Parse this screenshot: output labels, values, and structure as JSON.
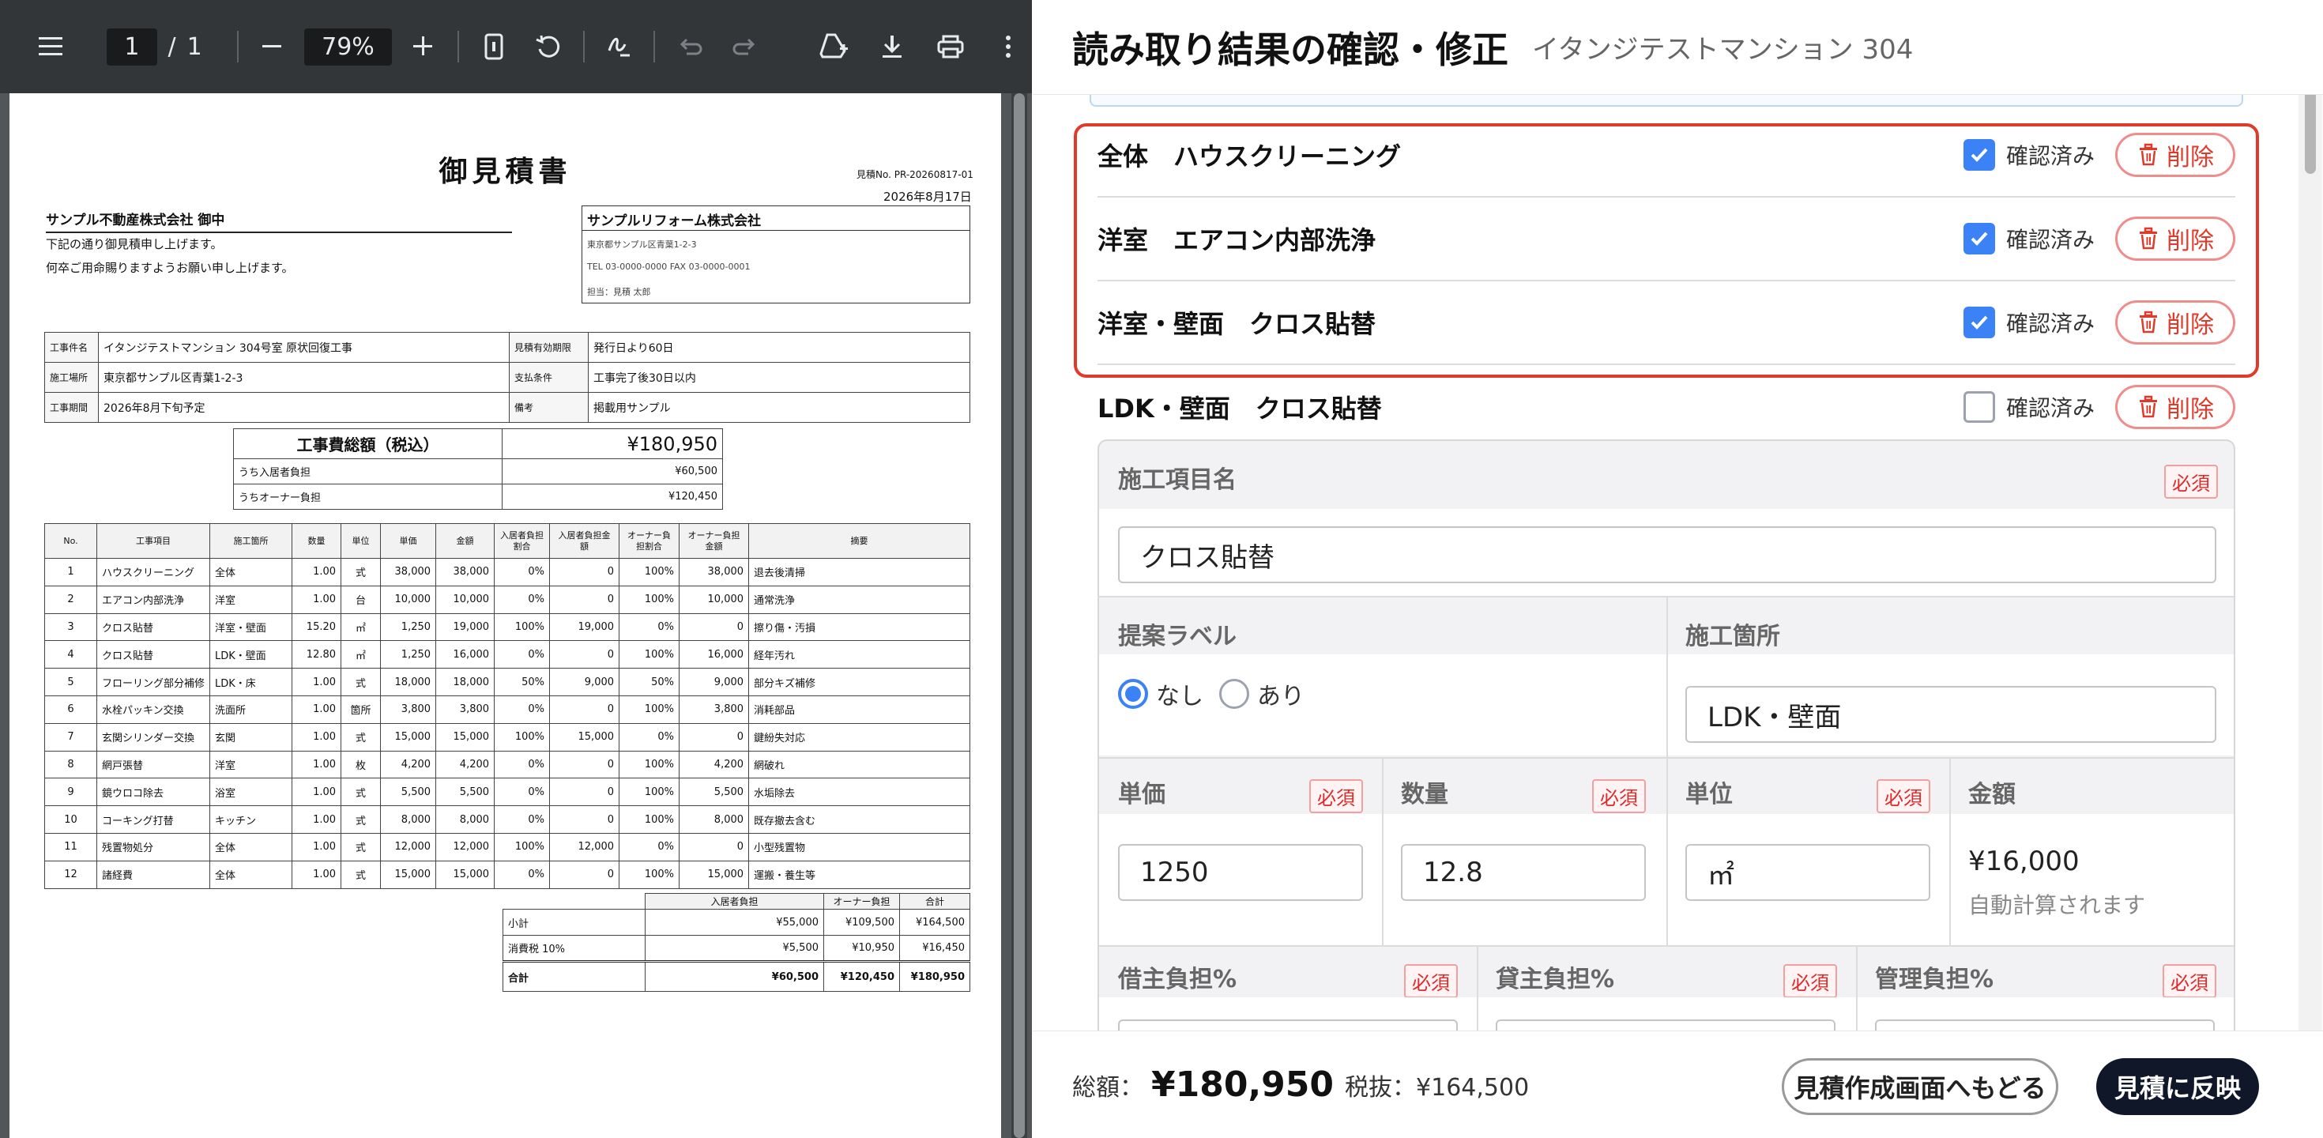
{
  "viewer": {
    "page_current": "1",
    "page_sep": "/",
    "page_total": "1",
    "zoom": "79%",
    "icons": [
      "menu-icon",
      "zoom-out-icon",
      "zoom-in-icon",
      "fit-page-icon",
      "rotate-icon",
      "draw-icon",
      "undo-icon",
      "redo-icon",
      "add-drive-icon",
      "download-icon",
      "print-icon",
      "more-icon"
    ]
  },
  "doc": {
    "title": "御見積書",
    "estimate_no": "見積No. PR-20260817-01",
    "date": "2026年8月17日",
    "client": "サンプル不動産株式会社 御中",
    "greeting1": "下記の通り御見積申し上げます。",
    "greeting2": "何卒ご用命賜りますようお願い申し上げます。",
    "company": "サンプルリフォーム株式会社",
    "company_addr": "東京都サンプル区青葉1-2-3",
    "company_tel": "TEL 03-0000-0000  FAX 03-0000-0001",
    "company_person": "担当：見積 太郎",
    "info": [
      [
        "工事件名",
        "イタンジテストマンション 304号室 原状回復工事",
        "見積有効期限",
        "発行日より60日"
      ],
      [
        "施工場所",
        "東京都サンプル区青葉1-2-3",
        "支払条件",
        "工事完了後30日以内"
      ],
      [
        "工事期間",
        "2026年8月下旬予定",
        "備考",
        "掲載用サンプル"
      ]
    ],
    "total_label": "工事費総額（税込）",
    "total_value": "¥180,950",
    "tenant_label": "うち入居者負担",
    "tenant_value": "¥60,500",
    "owner_label": "うちオーナー負担",
    "owner_value": "¥120,450",
    "headers": [
      "No.",
      "工事項目",
      "施工箇所",
      "数量",
      "単位",
      "単価",
      "金額",
      "入居者負担割合",
      "入居者負担金額",
      "オーナー負担割合",
      "オーナー負担金額",
      "摘要"
    ],
    "rows": [
      [
        "1",
        "ハウスクリーニング",
        "全体",
        "1.00",
        "式",
        "38,000",
        "38,000",
        "0%",
        "0",
        "100%",
        "38,000",
        "退去後清掃"
      ],
      [
        "2",
        "エアコン内部洗浄",
        "洋室",
        "1.00",
        "台",
        "10,000",
        "10,000",
        "0%",
        "0",
        "100%",
        "10,000",
        "通常洗浄"
      ],
      [
        "3",
        "クロス貼替",
        "洋室・壁面",
        "15.20",
        "㎡",
        "1,250",
        "19,000",
        "100%",
        "19,000",
        "0%",
        "0",
        "擦り傷・汚損"
      ],
      [
        "4",
        "クロス貼替",
        "LDK・壁面",
        "12.80",
        "㎡",
        "1,250",
        "16,000",
        "0%",
        "0",
        "100%",
        "16,000",
        "経年汚れ"
      ],
      [
        "5",
        "フローリング部分補修",
        "LDK・床",
        "1.00",
        "式",
        "18,000",
        "18,000",
        "50%",
        "9,000",
        "50%",
        "9,000",
        "部分キズ補修"
      ],
      [
        "6",
        "水栓パッキン交換",
        "洗面所",
        "1.00",
        "箇所",
        "3,800",
        "3,800",
        "0%",
        "0",
        "100%",
        "3,800",
        "消耗部品"
      ],
      [
        "7",
        "玄関シリンダー交換",
        "玄関",
        "1.00",
        "式",
        "15,000",
        "15,000",
        "100%",
        "15,000",
        "0%",
        "0",
        "鍵紛失対応"
      ],
      [
        "8",
        "網戸張替",
        "洋室",
        "1.00",
        "枚",
        "4,200",
        "4,200",
        "0%",
        "0",
        "100%",
        "4,200",
        "網破れ"
      ],
      [
        "9",
        "鏡ウロコ除去",
        "浴室",
        "1.00",
        "式",
        "5,500",
        "5,500",
        "0%",
        "0",
        "100%",
        "5,500",
        "水垢除去"
      ],
      [
        "10",
        "コーキング打替",
        "キッチン",
        "1.00",
        "式",
        "8,000",
        "8,000",
        "0%",
        "0",
        "100%",
        "8,000",
        "既存撤去含む"
      ],
      [
        "11",
        "残置物処分",
        "全体",
        "1.00",
        "式",
        "12,000",
        "12,000",
        "100%",
        "12,000",
        "0%",
        "0",
        "小型残置物"
      ],
      [
        "12",
        "諸経費",
        "全体",
        "1.00",
        "式",
        "15,000",
        "15,000",
        "0%",
        "0",
        "100%",
        "15,000",
        "運搬・養生等"
      ]
    ],
    "sum_headers": [
      "入居者負担",
      "オーナー負担",
      "合計"
    ],
    "sums": [
      [
        "小計",
        "¥55,000",
        "¥109,500",
        "¥164,500"
      ],
      [
        "消費税 10%",
        "¥5,500",
        "¥10,950",
        "¥16,450"
      ],
      [
        "合計",
        "¥60,500",
        "¥120,450",
        "¥180,950"
      ]
    ]
  },
  "panel": {
    "title": "読み取り結果の確認・修正",
    "subtitle": "イタンジテストマンション 304",
    "confirm_label": "確認済み",
    "delete_label": "削除",
    "items": [
      {
        "name": "全体　ハウスクリーニング",
        "checked": true
      },
      {
        "name": "洋室　エアコン内部洗浄",
        "checked": true
      },
      {
        "name": "洋室・壁面　クロス貼替",
        "checked": true
      },
      {
        "name": "LDK・壁面　クロス貼替",
        "checked": false
      }
    ],
    "form": {
      "required": "必須",
      "name_label": "施工項目名",
      "name_value": "クロス貼替",
      "proposal_label": "提案ラベル",
      "radio_none": "なし",
      "radio_yes": "あり",
      "location_label": "施工箇所",
      "location_value": "LDK・壁面",
      "price_label": "単価",
      "price_value": "1250",
      "qty_label": "数量",
      "qty_value": "12.8",
      "unit_label": "単位",
      "unit_value": "㎡",
      "amount_label": "金額",
      "amount_value": "¥16,000",
      "amount_note": "自動計算されます",
      "tenant_label": "借主負担%",
      "landlord_label": "貸主負担%",
      "mgmt_label": "管理負担%"
    },
    "footer": {
      "total_label": "総額：",
      "total_value": "¥180,950",
      "tax_label": "税抜：¥164,500",
      "back_button": "見積作成画面へもどる",
      "apply_button": "見積に反映"
    }
  },
  "colors": {
    "accent": "#3b82f6",
    "danger": "#e03a2b",
    "dark": "#0f1729"
  }
}
